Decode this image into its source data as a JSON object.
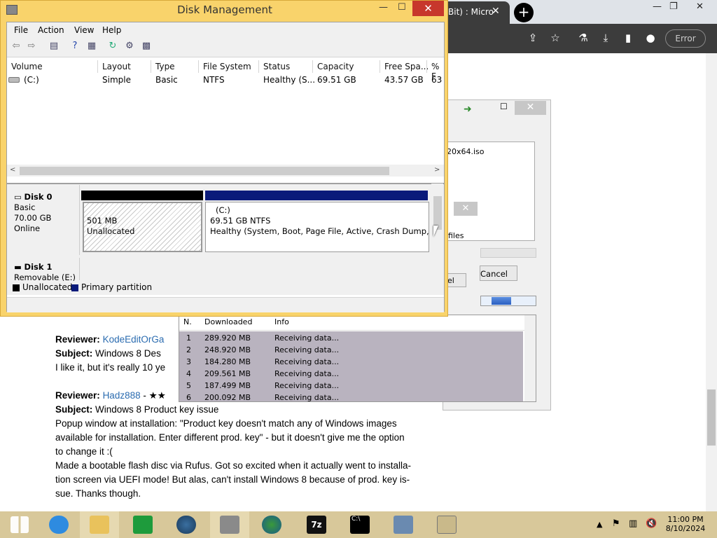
{
  "browser": {
    "tab_title": "Bit) : Micro",
    "error_label": "Error",
    "reviews": [
      {
        "reviewer_label": "Reviewer:",
        "reviewer": "KodeEditOrGa",
        "subject_label": "Subject:",
        "subject": "Windows 8 Des",
        "text": "I like it, but it's really 10 ye"
      },
      {
        "reviewer_label": "Reviewer:",
        "reviewer": "Hadz888",
        "stars": "- ★★",
        "subject_label": "Subject:",
        "subject": "Windows 8 Product key issue",
        "lines": [
          "Popup window at installation: \"Product key doesn't match any of Windows images",
          "available for installation. Enter different prod. key\" - but it doesn't give me the option",
          "to change it :(",
          "Made a bootable flash disc via Rufus. Got so excited when it actually went to installa-",
          "tion screen via UEFI mode! But alas, can't install Windows 8 because of prod. key is-",
          "sue. Thanks though."
        ]
      }
    ]
  },
  "download_manager": {
    "file_label": "20x64.iso",
    "files_label": "files",
    "cancel_label": "Cancel",
    "el_label": "el",
    "columns": [
      "N.",
      "Downloaded",
      "Info"
    ],
    "rows": [
      {
        "n": "1",
        "downloaded": "289.920  MB",
        "info": "Receiving data..."
      },
      {
        "n": "2",
        "downloaded": "248.920  MB",
        "info": "Receiving data..."
      },
      {
        "n": "3",
        "downloaded": "184.280  MB",
        "info": "Receiving data..."
      },
      {
        "n": "4",
        "downloaded": "209.561  MB",
        "info": "Receiving data..."
      },
      {
        "n": "5",
        "downloaded": "187.499  MB",
        "info": "Receiving data..."
      },
      {
        "n": "6",
        "downloaded": "200.092  MB",
        "info": "Receiving data..."
      }
    ]
  },
  "disk_mgmt": {
    "title": "Disk Management",
    "menu": [
      "File",
      "Action",
      "View",
      "Help"
    ],
    "columns": [
      "Volume",
      "Layout",
      "Type",
      "File System",
      "Status",
      "Capacity",
      "Free Spa...",
      "% F"
    ],
    "volume_row": {
      "volume": "(C:)",
      "layout": "Simple",
      "type": "Basic",
      "fs": "NTFS",
      "status": "Healthy (S...",
      "capacity": "69.51 GB",
      "free": "43.57 GB",
      "pct": "63"
    },
    "disk0": {
      "name": "Disk 0",
      "type": "Basic",
      "size": "70.00 GB",
      "state": "Online"
    },
    "unalloc_part": {
      "size": "501 MB",
      "label": "Unallocated"
    },
    "c_part": {
      "name": "(C:)",
      "size": "69.51 GB NTFS",
      "status": "Healthy (System, Boot, Page File, Active, Crash Dump, Pri"
    },
    "disk1": {
      "name": "Disk 1",
      "type": "Removable (E:)"
    },
    "legend": [
      "Unallocated",
      "Primary partition"
    ]
  },
  "taskbar": {
    "time": "11:00 PM",
    "date": "8/10/2024"
  }
}
